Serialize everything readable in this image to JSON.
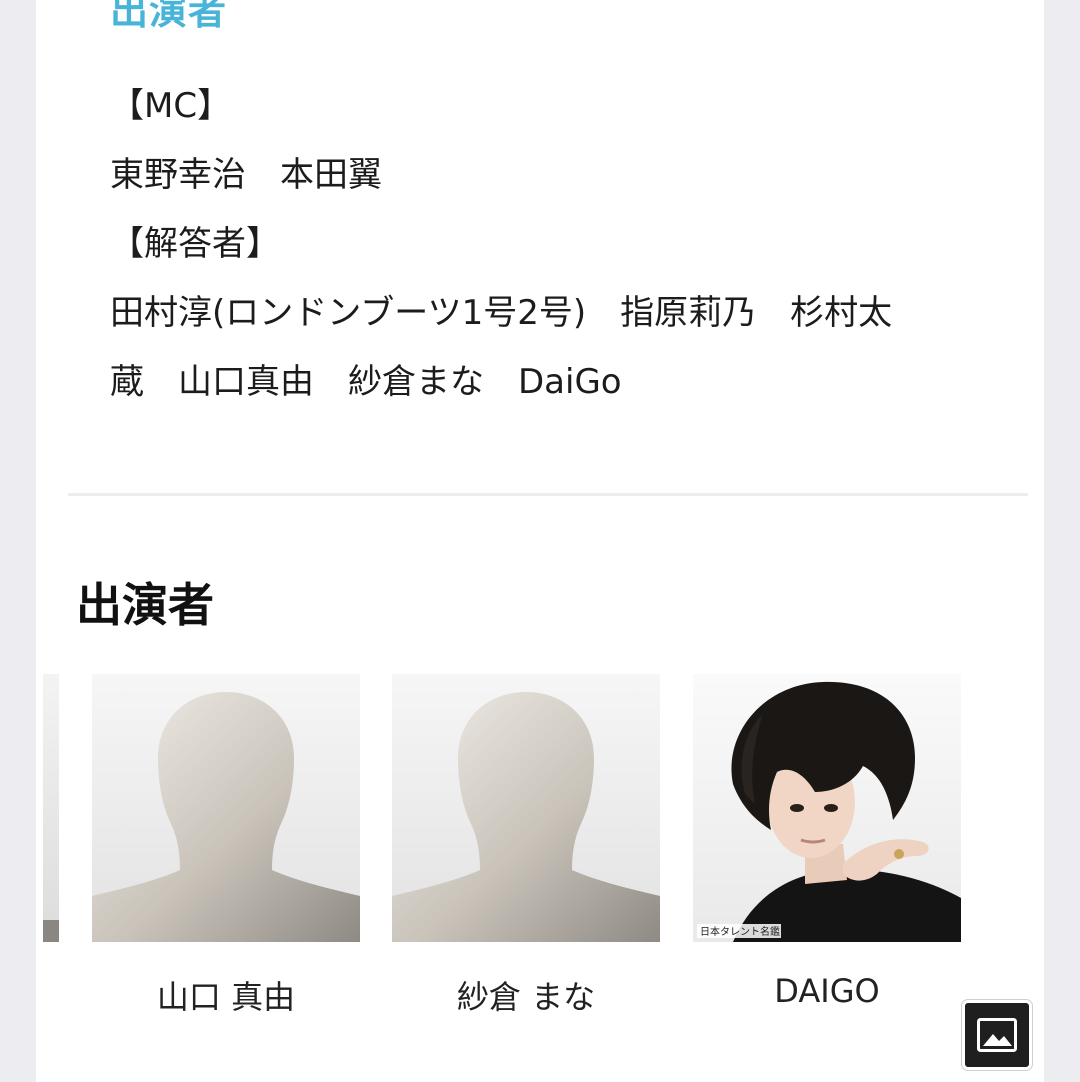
{
  "cast_section": {
    "heading": "出演者",
    "lines": [
      "【MC】",
      "東野幸治　本田翼",
      "【解答者】",
      "田村淳(ロンドンブーツ1号2号)　指原莉乃　杉村太",
      "蔵　山口真由　紗倉まな　DaiGo"
    ]
  },
  "performers_section": {
    "heading": "出演者",
    "people": [
      {
        "name": "山口 真由",
        "photo": "placeholder-silhouette"
      },
      {
        "name": "紗倉 まな",
        "photo": "placeholder-silhouette"
      },
      {
        "name": "DAIGO",
        "photo": "portrait",
        "photo_credit": "日本タレント名鑑"
      }
    ]
  },
  "floating_button": {
    "icon": "image-icon"
  },
  "colors": {
    "accent": "#48b4d8",
    "page_background": "#ececf1",
    "card_background": "#ffffff",
    "fab_background": "#1f1f1f"
  }
}
